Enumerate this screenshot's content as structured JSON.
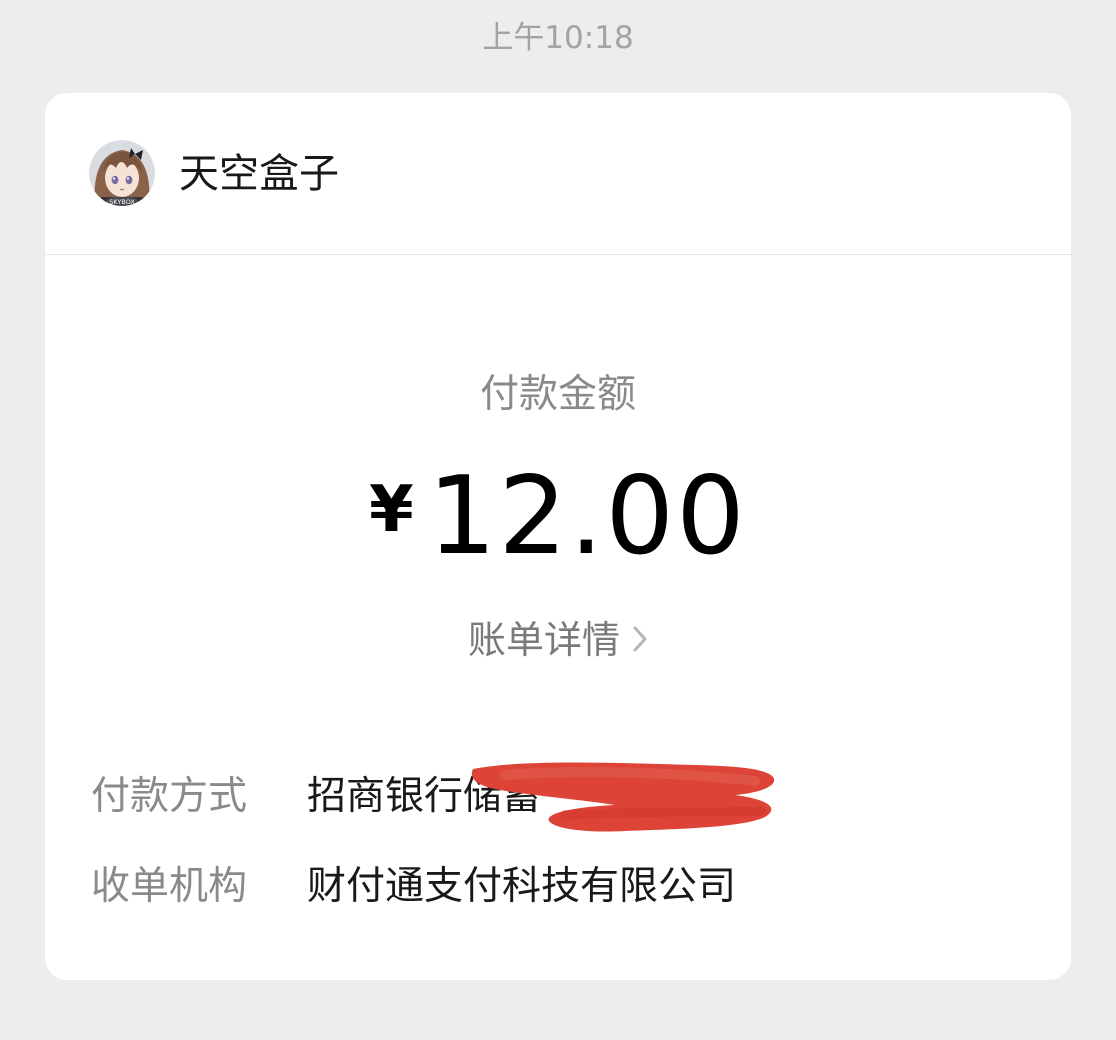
{
  "header": {
    "timestamp": "上午10:18"
  },
  "merchant": {
    "name": "天空盒子",
    "avatar_caption": "SKYBOX",
    "avatar_icon": "anime-character-avatar"
  },
  "payment": {
    "amount_label": "付款金额",
    "currency_symbol": "¥",
    "amount": "12.00",
    "bill_details_label": "账单详情",
    "bill_details_icon": "chevron-right-icon"
  },
  "details": [
    {
      "label": "付款方式",
      "value": "招商银行储蓄"
    },
    {
      "label": "收单机构",
      "value": "财付通支付科技有限公司"
    }
  ],
  "colors": {
    "background": "#ededed",
    "card": "#ffffff",
    "muted_text": "#8a8a8a",
    "redaction": "#dd4437"
  }
}
